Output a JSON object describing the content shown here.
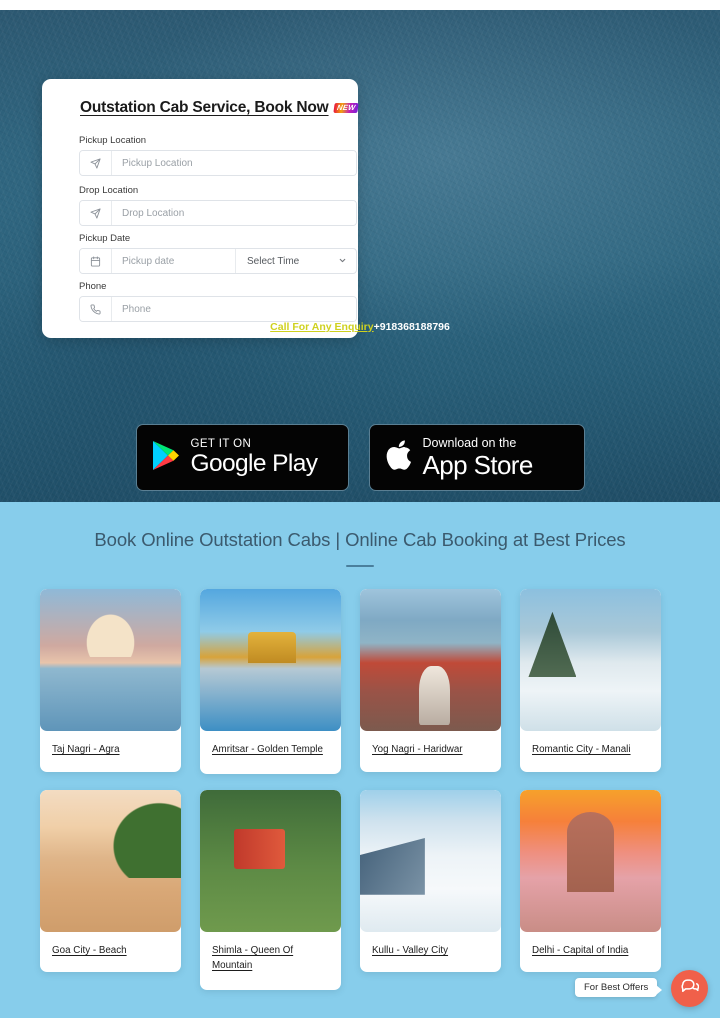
{
  "hero": {
    "booking_form": {
      "title": "Outstation Cab Service, Book Now",
      "new_badge": "NEW",
      "fields": [
        {
          "label": "Pickup Location",
          "placeholder": "Pickup Location",
          "icon": "navigation-arrow-icon"
        },
        {
          "label": "Drop Location",
          "placeholder": "Drop Location",
          "icon": "navigation-arrow-icon"
        },
        {
          "label": "Pickup Date",
          "placeholder": "Pickup date",
          "icon": "calendar-icon",
          "select_value": "Select Time"
        },
        {
          "label": "Phone",
          "placeholder": "Phone",
          "icon": "phone-icon"
        }
      ]
    },
    "enquiry": {
      "label": "Call For Any Enquiry",
      "phone": "+918368188796",
      "label_color": "#cfd11f",
      "phone_color": "#ffffff"
    },
    "store_badges": [
      {
        "small": "GET IT ON",
        "big": "Google Play",
        "icon": "google-play-icon"
      },
      {
        "small": "Download on the",
        "big": "App Store",
        "icon": "apple-icon"
      }
    ]
  },
  "destinations": {
    "title": "Book Online Outstation Cabs | Online Cab Booking at Best Prices",
    "bg_color": "#87cdeb",
    "title_color": "#3b5a6e",
    "rows": [
      [
        {
          "label": "Taj Nagri - Agra",
          "image": "taj-mahal-photo",
          "img_class": "img-taj"
        },
        {
          "label": "Amritsar - Golden Temple",
          "image": "golden-temple-photo",
          "img_class": "img-amritsar"
        },
        {
          "label": "Yog Nagri - Haridwar",
          "image": "haridwar-ghat-photo",
          "img_class": "img-haridwar"
        },
        {
          "label": "Romantic City - Manali",
          "image": "manali-snow-photo",
          "img_class": "img-manali"
        }
      ],
      [
        {
          "label": "Goa City - Beach",
          "image": "goa-beach-photo",
          "img_class": "img-goa"
        },
        {
          "label": "Shimla - Queen Of Mountain",
          "image": "shimla-toy-train-photo",
          "img_class": "img-shimla"
        },
        {
          "label": "Kullu - Valley City",
          "image": "kullu-snow-valley-photo",
          "img_class": "img-kullu"
        },
        {
          "label": "Delhi - Capital of India",
          "image": "india-gate-photo",
          "img_class": "img-delhi"
        }
      ]
    ]
  },
  "chat_widget": {
    "tooltip": "For Best Offers",
    "icon": "chat-bubble-icon",
    "color": "#f0604a"
  }
}
